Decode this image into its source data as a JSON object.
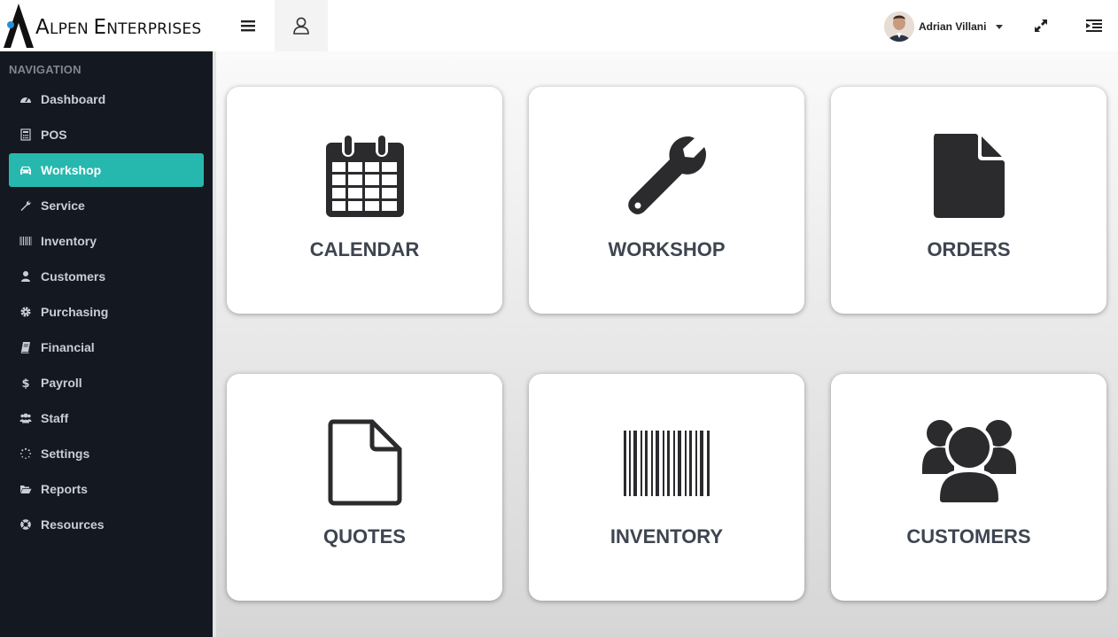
{
  "brand": {
    "name_first_cap": "A",
    "name_first_rest": "LPEN ",
    "name_second_cap": "E",
    "name_second_rest": "NTERPRISES"
  },
  "header": {
    "user_name": "Adrian Villani",
    "icons": {
      "menu": "hamburger-icon",
      "user": "user-outline-icon",
      "expand": "expand-arrows-icon",
      "collapse": "indent-icon"
    }
  },
  "sidebar": {
    "header": "NAVIGATION",
    "items": [
      {
        "label": "Dashboard",
        "icon": "dashboard-icon"
      },
      {
        "label": "POS",
        "icon": "calculator-icon"
      },
      {
        "label": "Workshop",
        "icon": "car-icon",
        "active": true
      },
      {
        "label": "Service",
        "icon": "wrench-icon"
      },
      {
        "label": "Inventory",
        "icon": "barcode-icon"
      },
      {
        "label": "Customers",
        "icon": "user-icon"
      },
      {
        "label": "Purchasing",
        "icon": "gear-icon"
      },
      {
        "label": "Financial",
        "icon": "book-icon"
      },
      {
        "label": "Payroll",
        "icon": "dollar-icon"
      },
      {
        "label": "Staff",
        "icon": "users-icon"
      },
      {
        "label": "Settings",
        "icon": "spinner-icon"
      },
      {
        "label": "Reports",
        "icon": "folder-open-icon"
      },
      {
        "label": "Resources",
        "icon": "lifebuoy-icon"
      }
    ],
    "active_color": "#26b8ae"
  },
  "tiles": [
    {
      "label": "CALENDAR",
      "icon": "calendar-icon"
    },
    {
      "label": "WORKSHOP",
      "icon": "wrench-icon"
    },
    {
      "label": "ORDERS",
      "icon": "document-filled-icon"
    },
    {
      "label": "QUOTES",
      "icon": "document-outline-icon"
    },
    {
      "label": "INVENTORY",
      "icon": "barcode-icon"
    },
    {
      "label": "CUSTOMERS",
      "icon": "users-icon"
    }
  ],
  "colors": {
    "sidebar_bg": "#141820",
    "tile_text": "#3e4550",
    "icon_color": "#2b2b2e"
  }
}
